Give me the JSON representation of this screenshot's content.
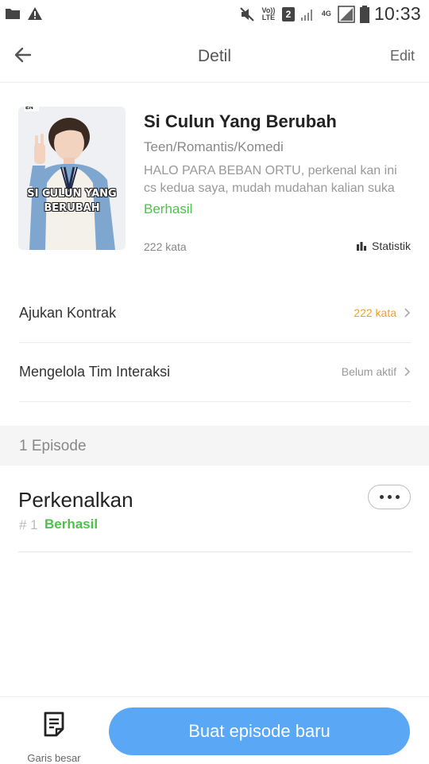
{
  "status_bar": {
    "time": "10:33",
    "volte": "Vo)) LTE",
    "sim": "2",
    "network": "4G",
    "icons": [
      "folder-icon",
      "warning-icon",
      "mute-icon",
      "signal-icon",
      "battery-icon"
    ]
  },
  "header": {
    "title": "Detil",
    "edit_label": "Edit"
  },
  "book": {
    "cover_text_line1": "SI CULUN YANG",
    "cover_text_line2": "BERUBAH",
    "cover_tag": "EN",
    "title": "Si Culun Yang Berubah",
    "genre": "Teen/Romantis/Komedi",
    "description": "HALO PARA BEBAN ORTU, perkenal kan ini cs kedua saya, mudah mudahan kalian suka",
    "status": "Berhasil",
    "word_count": "222 kata",
    "stats_label": "Statistik"
  },
  "rows": [
    {
      "label": "Ajukan Kontrak",
      "value": "222 kata"
    },
    {
      "label": "Mengelola Tim Interaksi",
      "value": "Belum aktif"
    }
  ],
  "section": {
    "label": "1 Episode"
  },
  "episodes": [
    {
      "title": "Perkenalkan",
      "number": "# 1",
      "status": "Berhasil"
    }
  ],
  "bottom": {
    "outline_label": "Garis besar",
    "new_episode_label": "Buat episode baru"
  },
  "colors": {
    "accent_blue": "#5aa8f5",
    "success_green": "#4cc24b",
    "warning_orange": "#f0a21e"
  }
}
